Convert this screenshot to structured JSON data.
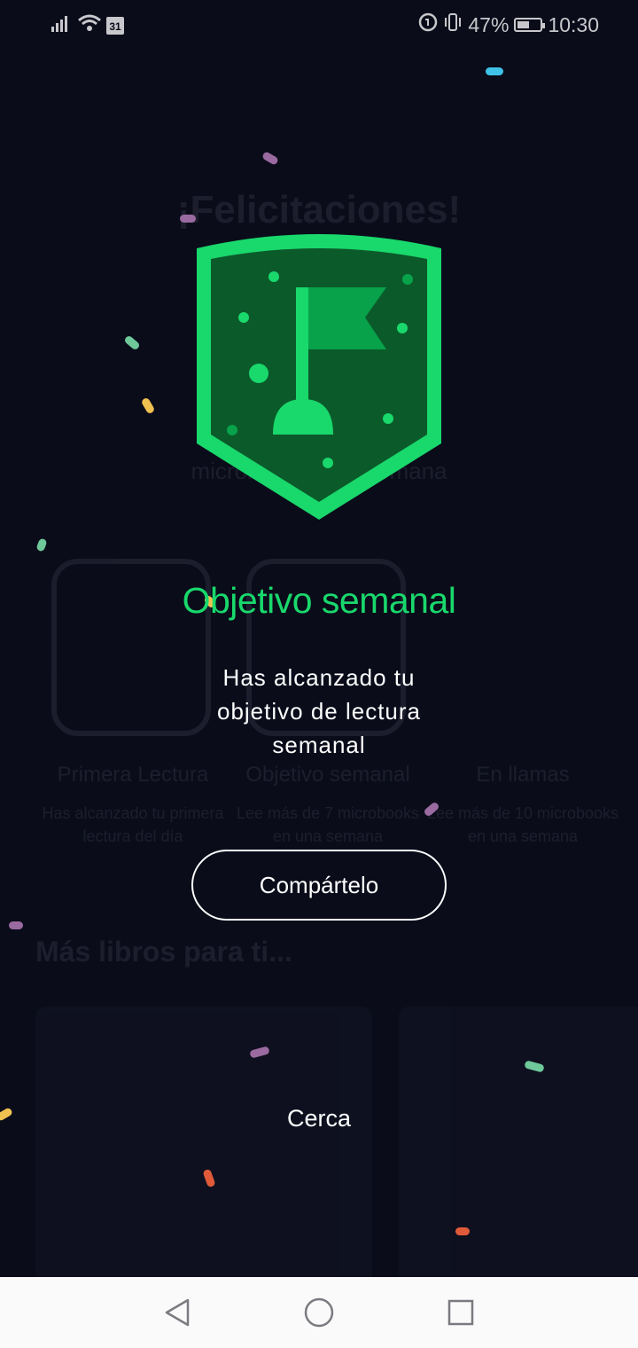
{
  "status_bar": {
    "calendar_day": "31",
    "battery": "47%",
    "time": "10:30",
    "icons": [
      "signal-icon",
      "wifi-icon",
      "calendar-icon",
      "data-saver-icon",
      "vibrate-icon",
      "battery-icon"
    ]
  },
  "background": {
    "title": "¡Felicitaciones!",
    "subtitle": "microbooks esta semana",
    "cards": [
      {
        "title": "Primera Lectura",
        "desc": "Has alcanzado tu primera lectura del día"
      },
      {
        "title": "Objetivo semanal",
        "desc": "Lee más de 7 microbooks en una semana"
      },
      {
        "title": "En llamas",
        "desc": "Lee más de 10 microbooks en una semana"
      }
    ],
    "more_books": "Más libros para ti..."
  },
  "modal": {
    "badge_icon": "flag-shield-icon",
    "title": "Objetivo semanal",
    "description": "Has alcanzado tu objetivo de lectura semanal",
    "share_label": "Compártelo",
    "close_label": "Cerca"
  },
  "colors": {
    "background": "#0a0c1a",
    "accent": "#19d86c",
    "badge_dark": "#0b5a2a",
    "badge_mid": "#07a24a"
  },
  "nav_bar": {
    "icons": [
      "back-icon",
      "home-icon",
      "recents-icon"
    ]
  }
}
